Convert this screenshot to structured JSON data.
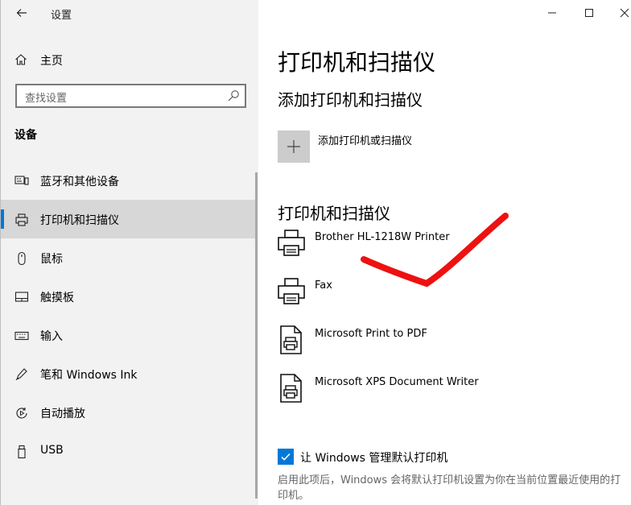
{
  "window": {
    "title": "设置"
  },
  "sidebar": {
    "home_label": "主页",
    "search_placeholder": "查找设置",
    "section_label": "设备",
    "items": [
      {
        "label": "蓝牙和其他设备",
        "icon": "bluetooth-devices-icon"
      },
      {
        "label": "打印机和扫描仪",
        "icon": "printer-icon",
        "selected": true
      },
      {
        "label": "鼠标",
        "icon": "mouse-icon"
      },
      {
        "label": "触摸板",
        "icon": "touchpad-icon"
      },
      {
        "label": "输入",
        "icon": "keyboard-icon"
      },
      {
        "label": "笔和 Windows Ink",
        "icon": "pen-icon"
      },
      {
        "label": "自动播放",
        "icon": "autoplay-icon"
      },
      {
        "label": "USB",
        "icon": "usb-icon"
      }
    ]
  },
  "main": {
    "page_title": "打印机和扫描仪",
    "add_section_title": "添加打印机和扫描仪",
    "add_button_label": "添加打印机或扫描仪",
    "list_section_title": "打印机和扫描仪",
    "devices": [
      {
        "name": "Brother HL-1218W Printer",
        "icon": "printer-icon"
      },
      {
        "name": "Fax",
        "icon": "fax-icon"
      },
      {
        "name": "Microsoft Print to PDF",
        "icon": "pdf-printer-icon"
      },
      {
        "name": "Microsoft XPS Document Writer",
        "icon": "xps-printer-icon"
      }
    ],
    "default_checkbox_label": "让 Windows 管理默认打印机",
    "default_checkbox_checked": true,
    "default_description": "启用此项后，Windows 会将默认打印机设置为你在当前位置最近使用的打印机。"
  },
  "colors": {
    "accent": "#0078d7",
    "sidebar_bg": "#f2f2f2",
    "selected_bg": "#d7d7d7",
    "scribble": "#ee1111"
  }
}
